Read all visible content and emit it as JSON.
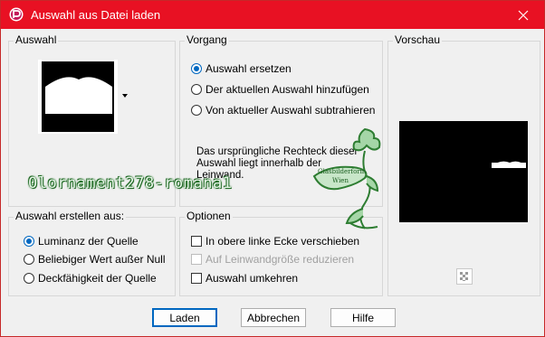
{
  "window": {
    "title": "Auswahl aus Datei laden",
    "close_icon": "close-icon"
  },
  "groups": {
    "auswahl": {
      "label": "Auswahl"
    },
    "vorgang": {
      "label": "Vorgang",
      "options": [
        {
          "label": "Auswahl ersetzen",
          "checked": true
        },
        {
          "label": "Der aktuellen Auswahl hinzufügen",
          "checked": false
        },
        {
          "label": "Von aktueller Auswahl subtrahieren",
          "checked": false
        }
      ],
      "info": "Das ursprüngliche Rechteck dieser Auswahl liegt innerhalb der Leinwand."
    },
    "vorschau": {
      "label": "Vorschau"
    },
    "erstellen": {
      "label": "Auswahl erstellen aus:",
      "options": [
        {
          "label": "Luminanz der Quelle",
          "checked": true
        },
        {
          "label": "Beliebiger Wert außer Null",
          "checked": false
        },
        {
          "label": "Deckfähigkeit der Quelle",
          "checked": false
        }
      ]
    },
    "optionen": {
      "label": "Optionen",
      "options": [
        {
          "label": "In obere linke Ecke verschieben",
          "checked": false,
          "disabled": false
        },
        {
          "label": "Auf Leinwandgröße reduzieren",
          "checked": false,
          "disabled": true
        },
        {
          "label": "Auswahl umkehren",
          "checked": false,
          "disabled": false
        }
      ]
    }
  },
  "buttons": {
    "load": "Laden",
    "cancel": "Abbrechen",
    "help": "Hilfe"
  },
  "watermark": {
    "filename": "0lornament278-romana1",
    "stamp_line1": "Glasbilderform",
    "stamp_line2": "Wien"
  },
  "colors": {
    "titlebar": "#e81123",
    "accent": "#0067c0",
    "watermark_green": "#2e7d32"
  }
}
